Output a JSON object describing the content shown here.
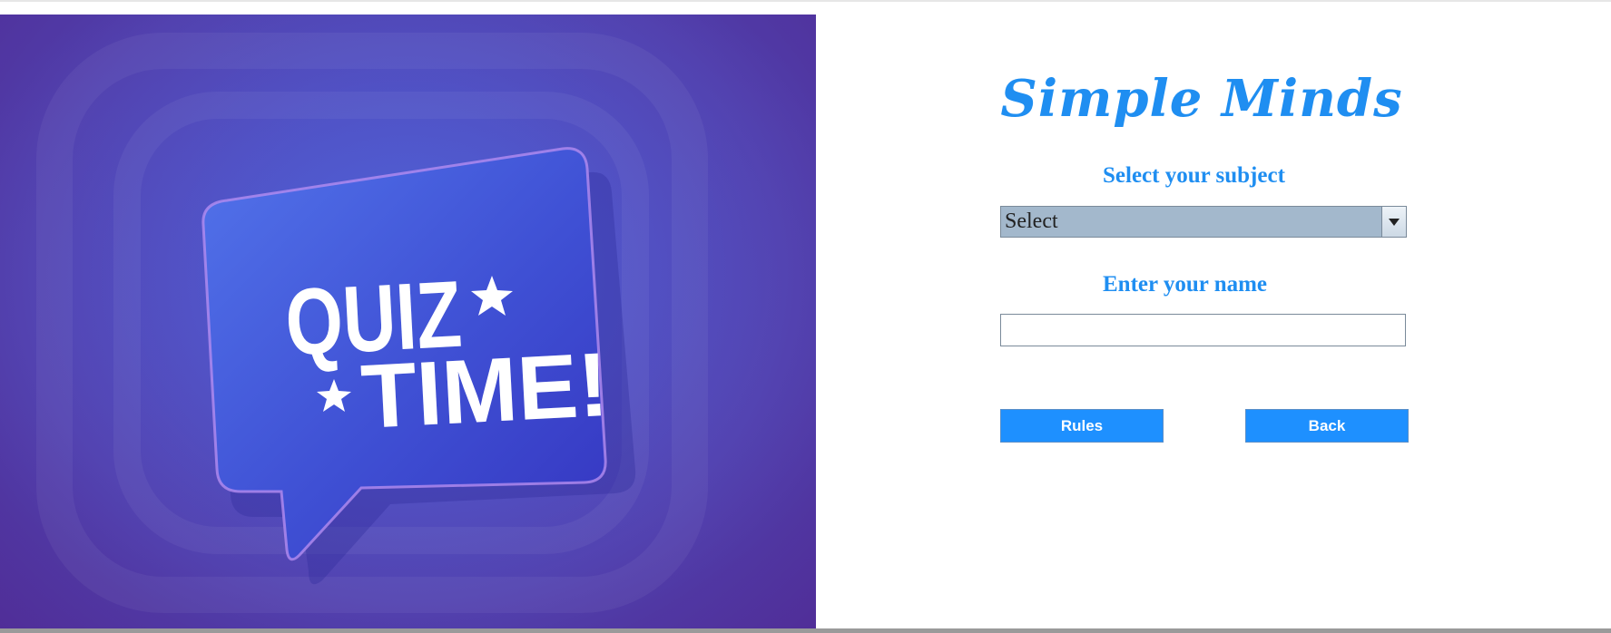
{
  "image_panel": {
    "word_line_1": "QUIZ",
    "word_line_2": "TIME!",
    "colors": {
      "background_center": "#4d63d9",
      "background_edge": "#5a2f99",
      "bubble": "#4058d8",
      "bubble_outline": "#b48cf0"
    }
  },
  "form": {
    "title": "Simple Minds",
    "subject_label": "Select your subject",
    "subject_select": {
      "selected_value": "Select"
    },
    "name_label": "Enter your name",
    "name_input": {
      "value": "",
      "placeholder": ""
    },
    "rules_button": "Rules",
    "back_button": "Back"
  },
  "colors": {
    "accent": "#1f8ef1",
    "button": "#1e90ff",
    "select_background": "#a3b8cc"
  },
  "icons": {
    "dropdown": "chevron-down-icon",
    "stars": "star-icon"
  }
}
